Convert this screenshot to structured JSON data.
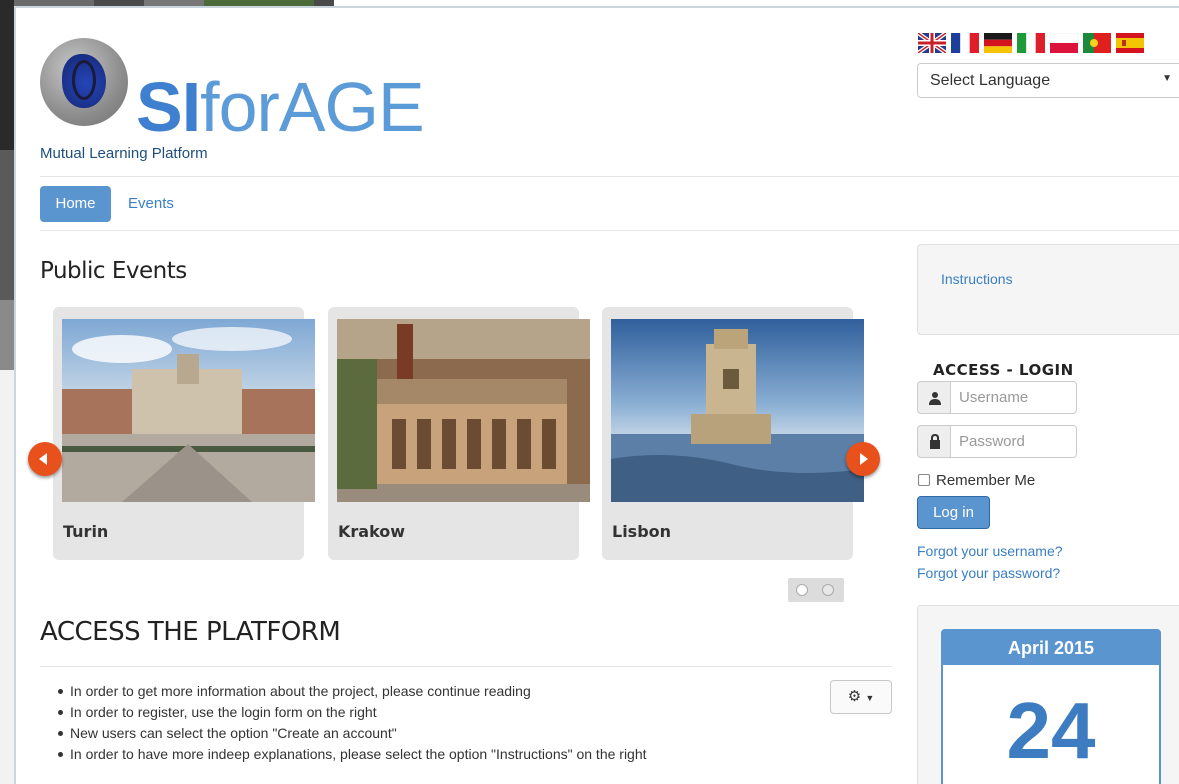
{
  "header": {
    "logo_si": "SI",
    "logo_rest": "forAGE",
    "tagline": "Mutual Learning Platform",
    "flags": [
      "uk-flag",
      "france-flag",
      "germany-flag",
      "italy-flag",
      "poland-flag",
      "portugal-flag",
      "spain-flag"
    ],
    "language_select": {
      "value": "Select Language"
    }
  },
  "nav": {
    "home": "Home",
    "events": "Events"
  },
  "public_events": {
    "title": "Public Events",
    "cards": [
      {
        "caption": "Turin"
      },
      {
        "caption": "Krakow"
      },
      {
        "caption": "Lisbon"
      }
    ]
  },
  "access": {
    "title": "ACCESS THE PLATFORM",
    "bullets": [
      "In order to get more information about the project, please continue reading",
      "In order to register, use the login form on the right",
      "New users can select the option \"Create an account\"",
      "In order to have more indeep explanations, please select the option \"Instructions\" on the right"
    ]
  },
  "sidebar": {
    "instructions_link": "Instructions",
    "login": {
      "title": "ACCESS - LOGIN",
      "username_placeholder": "Username",
      "password_placeholder": "Password",
      "remember_label": "Remember Me",
      "login_button": "Log in",
      "forgot_username": "Forgot your username?",
      "forgot_password": "Forgot your password?"
    },
    "calendar": {
      "month": "April 2015",
      "day": "24"
    }
  },
  "colors": {
    "accent": "#5b95d0",
    "link": "#3a7fc4",
    "arrow": "#e8501c"
  }
}
